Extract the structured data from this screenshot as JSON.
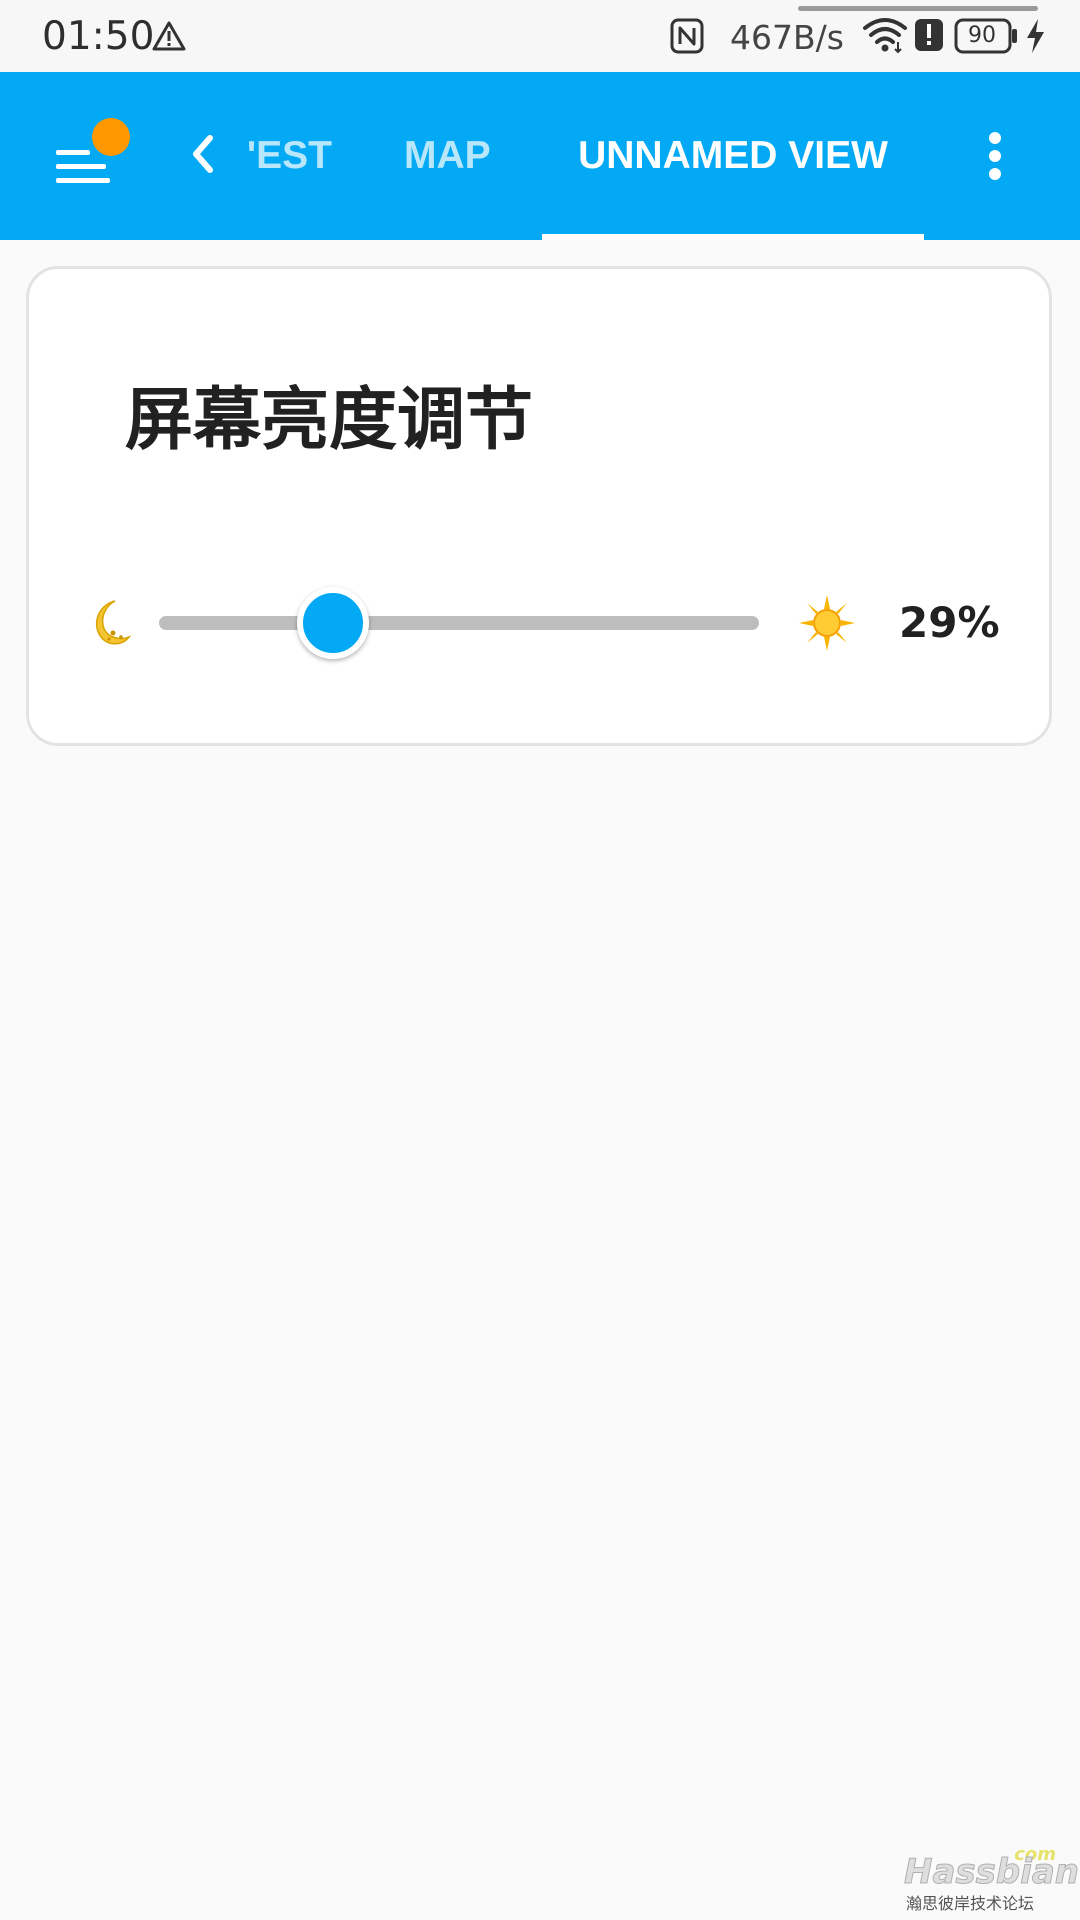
{
  "status_bar": {
    "time": "01:50",
    "net_speed": "467B/s",
    "battery_level": "90",
    "icons": [
      "warning-icon",
      "nfc-icon",
      "wifi-icon",
      "alert-icon",
      "battery-icon",
      "charging-icon"
    ]
  },
  "header": {
    "background_color": "#03a9f4",
    "notification_color": "#ff9800",
    "icons": [
      "menu-icon",
      "chevron-left-icon",
      "more-vert-icon"
    ],
    "tabs": [
      {
        "label": "TEST",
        "visible_text": "'EST",
        "selected": false
      },
      {
        "label": "MAP",
        "visible_text": "MAP",
        "selected": false
      },
      {
        "label": "UNNAMED VIEW",
        "visible_text": "UNNAMED VIEW",
        "selected": true
      }
    ]
  },
  "card": {
    "title": "屏幕亮度调节",
    "brightness": {
      "value": 29,
      "value_text": "29%",
      "min_icon": "moon-icon",
      "max_icon": "sun-icon",
      "accent_color": "#03a9f4"
    }
  },
  "watermark": {
    "brand": "Hassbian",
    "domain_suffix": "com",
    "subtitle": "瀚思彼岸技术论坛"
  }
}
